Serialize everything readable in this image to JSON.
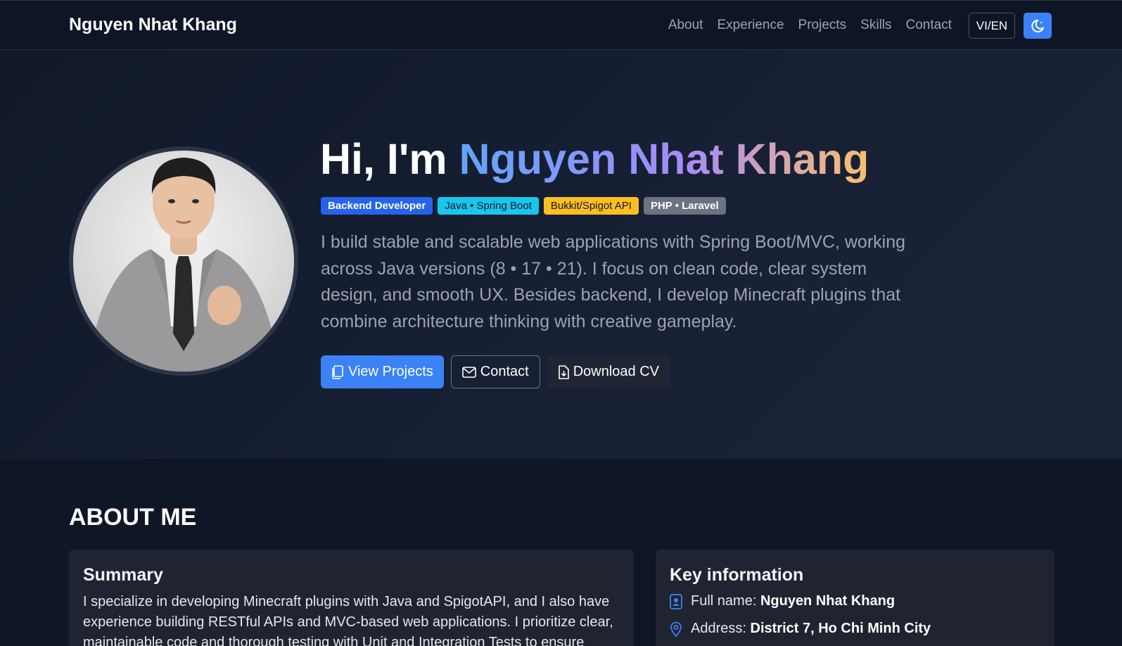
{
  "navbar": {
    "brand": "Nguyen Nhat Khang",
    "links": [
      "About",
      "Experience",
      "Projects",
      "Skills",
      "Contact"
    ],
    "lang_toggle": "VI/EN",
    "theme_icon": "moon-icon"
  },
  "hero": {
    "greeting": "Hi, I'm",
    "name": "Nguyen Nhat Khang",
    "badges": [
      "Backend Developer",
      "Java • Spring Boot",
      "Bukkit/Spigot API",
      "PHP • Laravel"
    ],
    "intro": "I build stable and scalable web applications with Spring Boot/MVC, working across Java versions (8 • 17 • 21). I focus on clean code, clear system design, and smooth UX. Besides backend, I develop Minecraft plugins that combine architecture thinking with creative gameplay.",
    "buttons": {
      "projects": "View Projects",
      "contact": "Contact",
      "cv": "Download CV"
    }
  },
  "about": {
    "title": "ABOUT ME",
    "summary": {
      "title": "Summary",
      "text": "I specialize in developing Minecraft plugins with Java and SpigotAPI, and I also have experience building RESTful APIs and MVC-based web applications. I prioritize clear, maintainable code and thorough testing with Unit and Integration Tests to ensure"
    },
    "key_info": {
      "title": "Key information",
      "full_name_label": "Full name:",
      "full_name": "Nguyen Nhat Khang",
      "address_label": "Address:",
      "address": "District 7, Ho Chi Minh City"
    }
  },
  "colors": {
    "accent": "#3b82f6",
    "background": "#0f1626",
    "card": "#1f2430"
  }
}
